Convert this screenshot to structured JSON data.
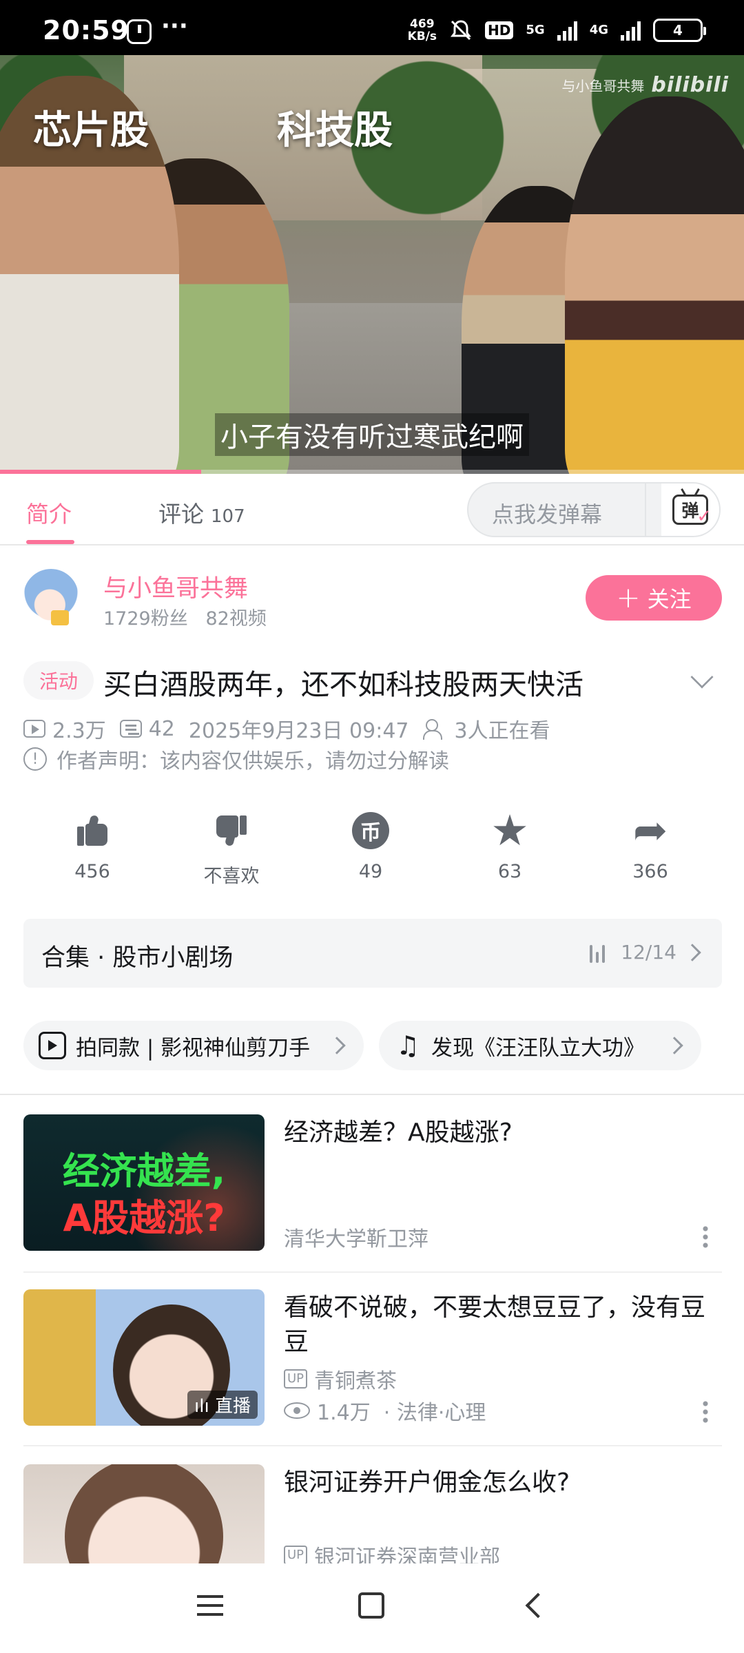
{
  "status_bar": {
    "time": "20:59",
    "net_speed_value": "469",
    "net_speed_unit": "KB/s",
    "hd_label": "HD",
    "net_5g": "5G",
    "net_4g": "4G",
    "battery": "4",
    "more_dots": "···"
  },
  "video": {
    "overlay_left": "芯片股",
    "overlay_right": "科技股",
    "watermark_uploader": "与小鱼哥共舞",
    "watermark_logo": "bilibili",
    "subtitle": "小子有没有听过寒武纪啊",
    "progress_fraction": 0.27,
    "progress_color": "#fb7299"
  },
  "tabs": {
    "intro": "简介",
    "comments": "评论",
    "comments_count": "107",
    "danmaku_placeholder": "点我发弹幕",
    "danmaku_icon_glyph": "弹"
  },
  "uploader": {
    "name": "与小鱼哥共舞",
    "fans": "1729粉丝",
    "videos": "82视频",
    "follow_label": "关注",
    "follow_plus": "+"
  },
  "video_info": {
    "badge": "活动",
    "title": "买白酒股两年，还不如科技股两天快活",
    "views": "2.3万",
    "danmaku": "42",
    "date": "2025年9月23日 09:47",
    "watching": "3人正在看",
    "declaration": "作者声明：该内容仅供娱乐，请勿过分解读"
  },
  "actions": {
    "like": "456",
    "dislike": "不喜欢",
    "coin": "49",
    "coin_glyph": "币",
    "favorite": "63",
    "share": "366"
  },
  "collection": {
    "label": "合集 · 股市小剧场",
    "episode": "12/14"
  },
  "chips": {
    "same_style": "拍同款 | 影视神仙剪刀手",
    "music": "发现《汪汪队立大功》"
  },
  "recommendations": [
    {
      "title": "经济越差？A股越涨?",
      "author": "清华大学靳卫萍",
      "thumb_line1": "经济越差,",
      "thumb_line2": "A股越涨?"
    },
    {
      "title": "看破不说破，不要太想豆豆了，没有豆豆",
      "up_tag": "UP",
      "author": "青铜煮茶",
      "views": "1.4万",
      "category": "· 法律·心理",
      "live_label": "直播"
    },
    {
      "title": "银河证券开户佣金怎么收?",
      "up_tag": "UP",
      "author": "银河证券深南营业部"
    }
  ],
  "colors": {
    "accent": "#fb7299",
    "text_secondary": "#9499a0"
  },
  "icons": [
    "app-icon",
    "mute-icon",
    "signal-icon",
    "battery-icon",
    "danmaku-icon",
    "play-count-icon",
    "danmaku-count-icon",
    "viewers-icon",
    "info-icon",
    "like-icon",
    "dislike-icon",
    "coin-icon",
    "favorite-icon",
    "share-icon",
    "playlist-icon",
    "video-camera-icon",
    "music-note-icon",
    "more-icon",
    "eye-icon",
    "menu-icon",
    "home-icon",
    "back-icon"
  ]
}
